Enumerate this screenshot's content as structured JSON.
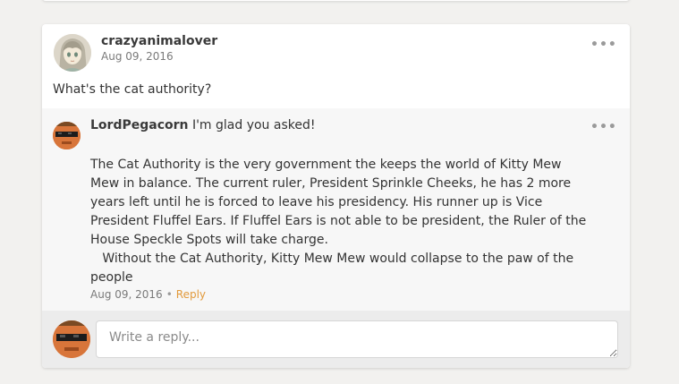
{
  "post": {
    "username": "crazyanimalover",
    "date": "Aug 09, 2016",
    "text": "What's the cat authority?",
    "more_icon": "•••"
  },
  "reply": {
    "username": "LordPegacorn",
    "intro": "I'm glad you asked!",
    "body_paragraphs": [
      "The Cat Authority is the very government the keeps the world of Kitty Mew Mew in balance. The current ruler, President Sprinkle Cheeks, he has 2 more years left until he is forced to leave his presidency. His runner up is Vice President Fluffel Ears. If Fluffel Ears is not able to be president, the Ruler of the House Speckle Spots will take charge.",
      "   Without the Cat Authority, Kitty Mew Mew would collapse to the paw of the people"
    ],
    "date": "Aug 09, 2016",
    "separator": "•",
    "reply_label": "Reply",
    "more_icon": "•••"
  },
  "compose": {
    "placeholder": "Write a reply..."
  },
  "colors": {
    "accent": "#e29a3c",
    "background": "#f2f1ef",
    "avatar_orange": "#d8753a"
  },
  "icons": {
    "post_avatar": "anime-girl-avatar",
    "reply_avatar": "sunglasses-pumpkin-avatar",
    "more": "ellipsis-icon"
  }
}
